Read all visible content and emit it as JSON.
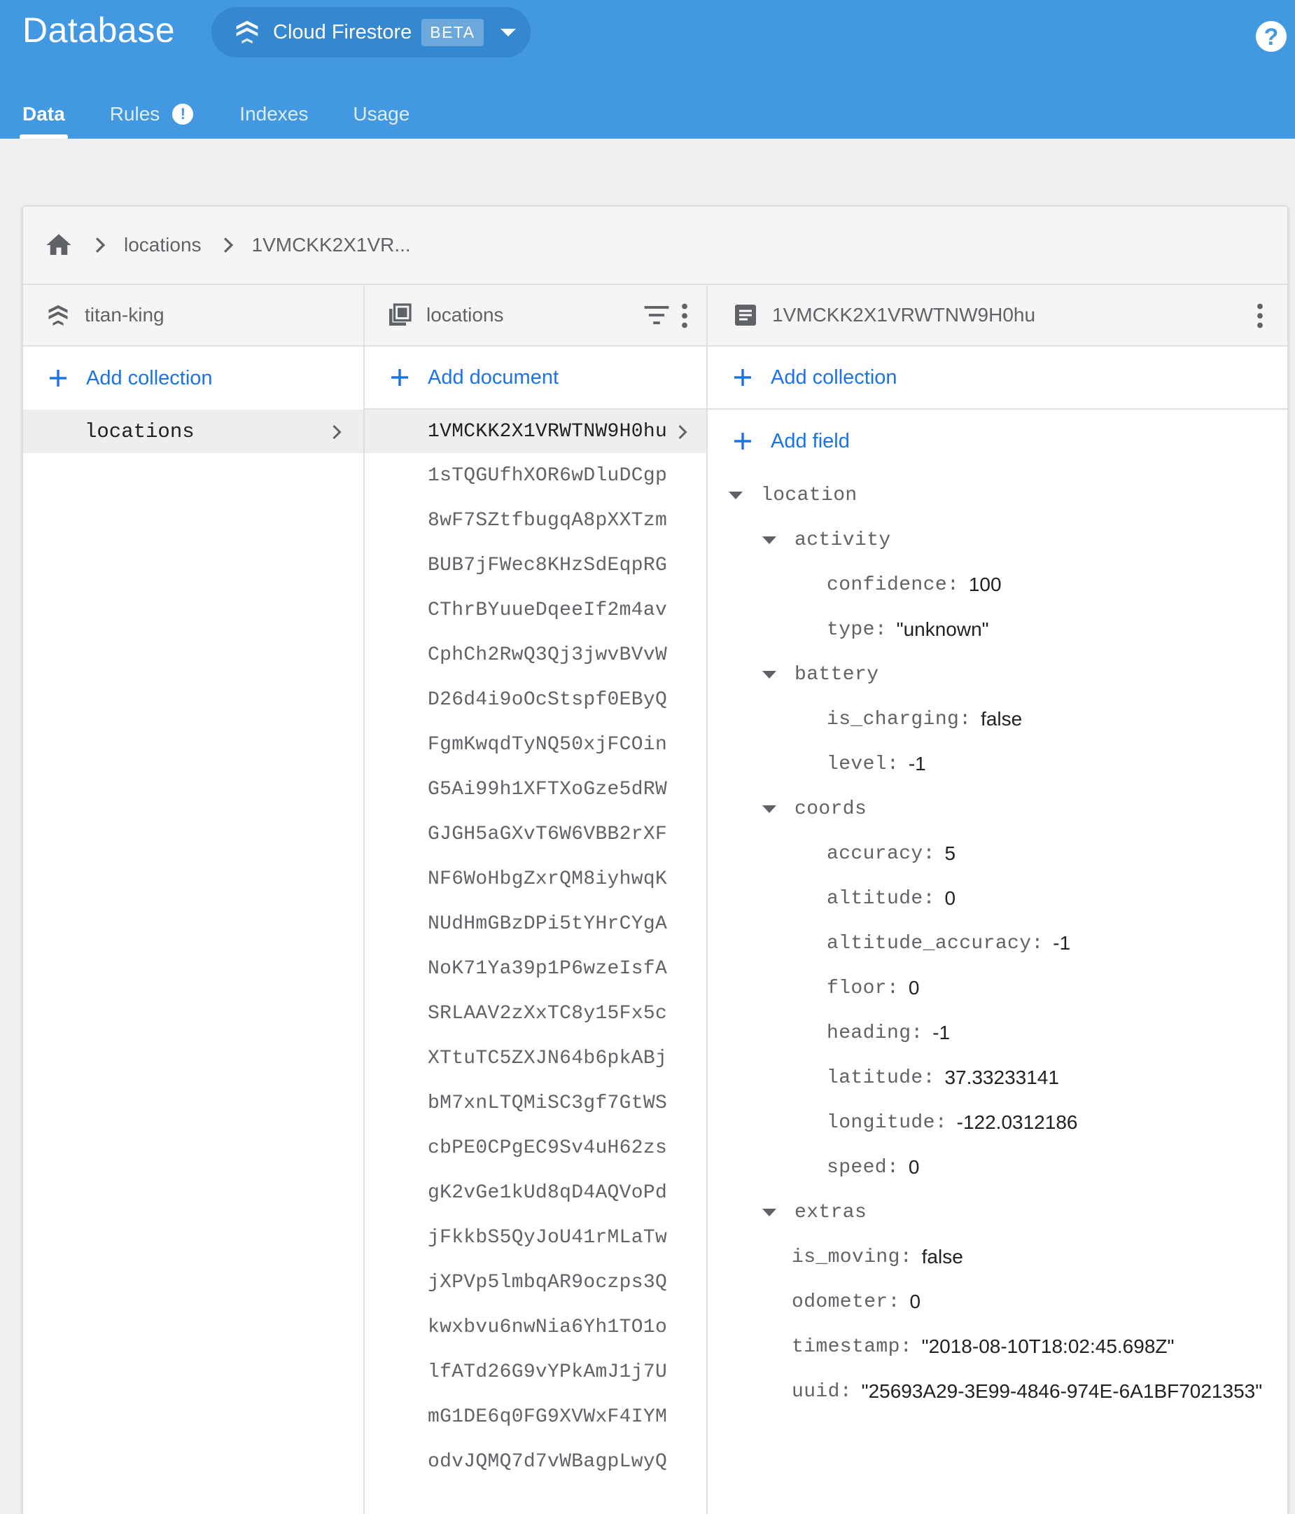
{
  "header": {
    "title": "Database",
    "product": "Cloud Firestore",
    "badge": "BETA",
    "help": "?"
  },
  "tabs": [
    {
      "label": "Data",
      "active": true
    },
    {
      "label": "Rules",
      "alert": "!"
    },
    {
      "label": "Indexes"
    },
    {
      "label": "Usage"
    }
  ],
  "breadcrumb": [
    "locations",
    "1VMCKK2X1VR..."
  ],
  "root": {
    "title": "titan-king",
    "add_label": "Add collection",
    "collections": [
      "locations"
    ]
  },
  "collection": {
    "title": "locations",
    "add_label": "Add document",
    "documents": [
      "1VMCKK2X1VRWTNW9H0hu",
      "1sTQGUfhXOR6wDluDCgp",
      "8wF7SZtfbugqA8pXXTzm",
      "BUB7jFWec8KHzSdEqpRG",
      "CThrBYuueDqeeIf2m4av",
      "CphCh2RwQ3Qj3jwvBVvW",
      "D26d4i9oOcStspf0EByQ",
      "FgmKwqdTyNQ50xjFCOin",
      "G5Ai99h1XFTXoGze5dRW",
      "GJGH5aGXvT6W6VBB2rXF",
      "NF6WoHbgZxrQM8iyhwqK",
      "NUdHmGBzDPi5tYHrCYgA",
      "NoK71Ya39p1P6wzeIsfA",
      "SRLAAV2zXxTC8y15Fx5c",
      "XTtuTC5ZXJN64b6pkABj",
      "bM7xnLTQMiSC3gf7GtWS",
      "cbPE0CPgEC9Sv4uH62zs",
      "gK2vGe1kUd8qD4AQVoPd",
      "jFkkbS5QyJoU41rMLaTw",
      "jXPVp5lmbqAR9oczps3Q",
      "kwxbvu6nwNia6Yh1TO1o",
      "lfATd26G9vYPkAmJ1j7U",
      "mG1DE6q0FG9XVWxF4IYM",
      "odvJQMQ7d7vWBagpLwyQ"
    ]
  },
  "document": {
    "title": "1VMCKK2X1VRWTNW9H0hu",
    "add_collection_label": "Add collection",
    "add_field_label": "Add field",
    "fields": [
      {
        "key": "location",
        "depth": 0,
        "expandable": true
      },
      {
        "key": "activity",
        "depth": 1,
        "expandable": true
      },
      {
        "key": "confidence",
        "depth": 2,
        "value": "100"
      },
      {
        "key": "type",
        "depth": 2,
        "value": "\"unknown\""
      },
      {
        "key": "battery",
        "depth": 1,
        "expandable": true
      },
      {
        "key": "is_charging",
        "depth": 2,
        "value": "false"
      },
      {
        "key": "level",
        "depth": 2,
        "value": "-1"
      },
      {
        "key": "coords",
        "depth": 1,
        "expandable": true
      },
      {
        "key": "accuracy",
        "depth": 2,
        "value": "5"
      },
      {
        "key": "altitude",
        "depth": 2,
        "value": "0"
      },
      {
        "key": "altitude_accuracy",
        "depth": 2,
        "value": "-1"
      },
      {
        "key": "floor",
        "depth": 2,
        "value": "0"
      },
      {
        "key": "heading",
        "depth": 2,
        "value": "-1"
      },
      {
        "key": "latitude",
        "depth": 2,
        "value": "37.33233141"
      },
      {
        "key": "longitude",
        "depth": 2,
        "value": "-122.0312186"
      },
      {
        "key": "speed",
        "depth": 2,
        "value": "0"
      },
      {
        "key": "extras",
        "depth": 1,
        "expandable": true
      },
      {
        "key": "is_moving",
        "depth": 1,
        "value": "false"
      },
      {
        "key": "odometer",
        "depth": 1,
        "value": "0"
      },
      {
        "key": "timestamp",
        "depth": 1,
        "value": "\"2018-08-10T18:02:45.698Z\""
      },
      {
        "key": "uuid",
        "depth": 1,
        "value": "\"25693A29-3E99-4846-974E-6A1BF7021353\""
      }
    ]
  },
  "icons": {
    "firestore": "firestore-icon",
    "home": "home-icon",
    "collection": "collection-icon",
    "document": "document-icon",
    "filter": "filter-icon",
    "more": "more-vert-icon",
    "add": "plus-icon"
  },
  "colors": {
    "header_bg": "#4299e1",
    "accent": "#1a73e8"
  }
}
